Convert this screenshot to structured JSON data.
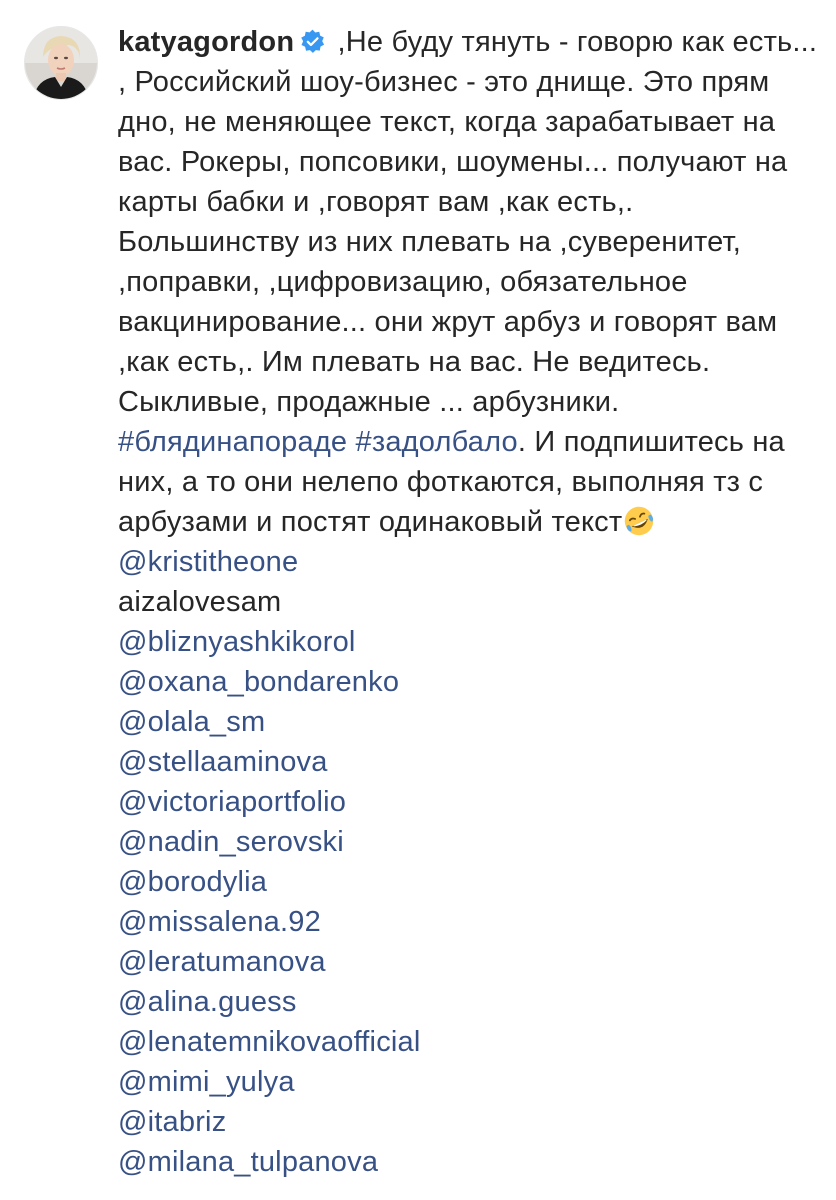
{
  "post": {
    "username": "katyagordon",
    "caption": {
      "part1": " ,Не буду тянуть - говорю как есть... , Российский шоу-бизнес - это днище. Это прям дно, не меняющее текст, когда зарабатывает на вас. Рокеры, попсовики, шоумены... получают на карты бабки и ,говорят вам ,как есть,. Большинству из них плевать на ,суверенитет, ,поправки, ,цифровизацию, обязательное вакцинирование... они жрут арбуз и говорят вам ,как есть,. Им плевать на вас. Не ведитесь. Сыкливые, продажные ... арбузники. ",
      "hashtag1": "#блядинапораде",
      "hashtag2": "#задолбало",
      "part2": ". И подпишитесь на них, а то они нелепо фоткаются, выполняя тз с арбузами и постят одинаковый текст"
    },
    "mentions": [
      {
        "text": "@kristitheone",
        "linked": true
      },
      {
        "text": "aizalovesam",
        "linked": false
      },
      {
        "text": "@bliznyashkikorol",
        "linked": true
      },
      {
        "text": "@oxana_bondarenko",
        "linked": true
      },
      {
        "text": "@olala_sm",
        "linked": true
      },
      {
        "text": "@stellaaminova",
        "linked": true
      },
      {
        "text": "@victoriaportfolio",
        "linked": true
      },
      {
        "text": "@nadin_serovski",
        "linked": true
      },
      {
        "text": "@borodylia",
        "linked": true
      },
      {
        "text": "@missalena.92",
        "linked": true
      },
      {
        "text": "@leratumanova",
        "linked": true
      },
      {
        "text": "@alina.guess",
        "linked": true
      },
      {
        "text": "@lenatemnikovaofficial",
        "linked": true
      },
      {
        "text": "@mimi_yulya",
        "linked": true
      },
      {
        "text": "@itabriz",
        "linked": true
      },
      {
        "text": "@milana_tulpanova",
        "linked": true
      }
    ],
    "icons": {
      "avatar": "profile-photo",
      "verified": "verified-badge-icon",
      "emoji": "rolling-on-floor-laughing-emoji"
    },
    "colors": {
      "text": "#262626",
      "link": "#385185",
      "verified": "#3897f0",
      "emoji": "#ffcc4d"
    }
  }
}
